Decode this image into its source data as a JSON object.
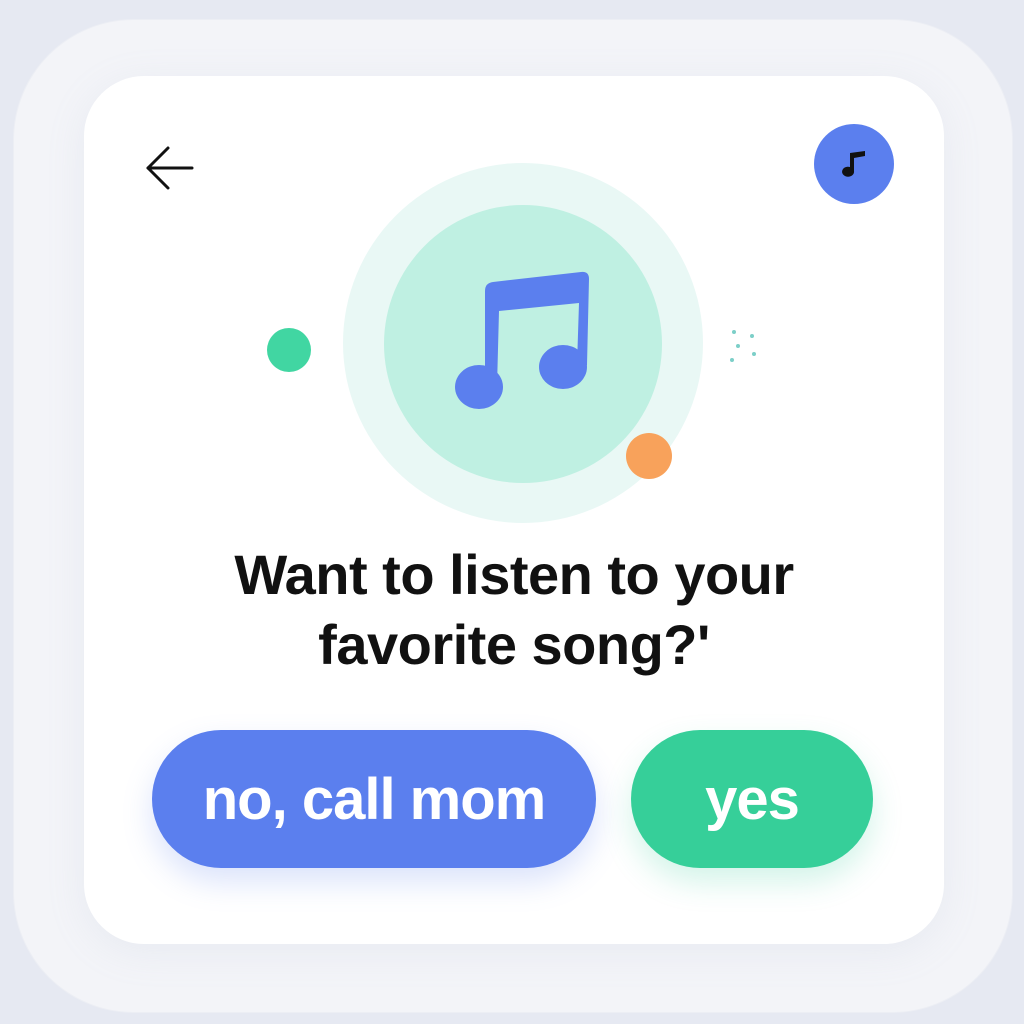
{
  "header": {
    "back_icon": "arrow-left-icon",
    "badge_icon": "music-note-icon"
  },
  "hero": {
    "icon": "music-notes-icon"
  },
  "prompt": {
    "line1": "Want to listen to your",
    "line2": "favorite song?'"
  },
  "actions": {
    "no_label": "no, call mom",
    "yes_label": "yes"
  },
  "colors": {
    "primary_blue": "#5b7fee",
    "accent_green": "#36cf99",
    "accent_orange": "#f8a25b",
    "mint": "#bff0e2"
  }
}
